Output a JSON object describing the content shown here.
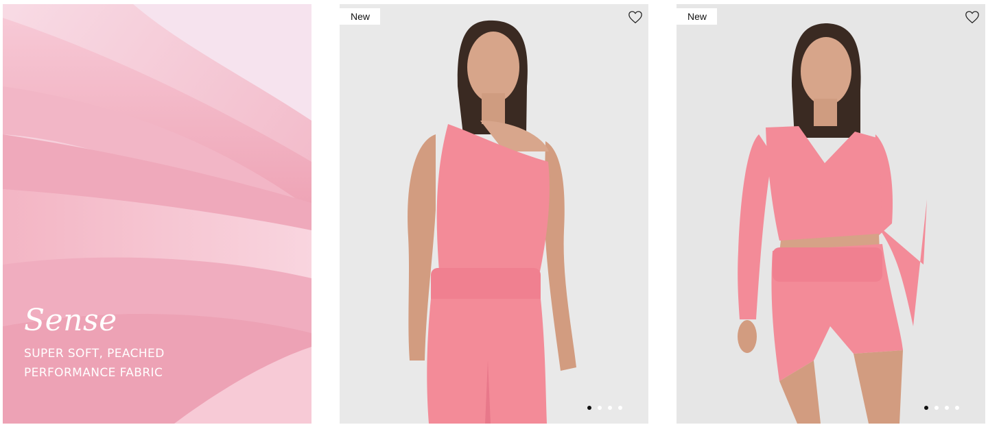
{
  "promo": {
    "title": "Sense",
    "subtitle": "SUPER SOFT, PEACHED PERFORMANCE FABRIC"
  },
  "products": [
    {
      "badge": "New",
      "wishlist_icon": "heart-outline-icon",
      "image_subject": "model in pink one-shoulder top and leggings",
      "carousel_dots": 4,
      "active_dot": 1
    },
    {
      "badge": "New",
      "wishlist_icon": "heart-outline-icon",
      "image_subject": "model in pink wrap long-sleeve top and shorts",
      "carousel_dots": 4,
      "active_dot": 1
    }
  ],
  "colors": {
    "fabric_pink": "#f4b9c8",
    "garment_pink": "#f38b98",
    "studio_bg": "#eaeaea",
    "active_dot": "#111111"
  }
}
